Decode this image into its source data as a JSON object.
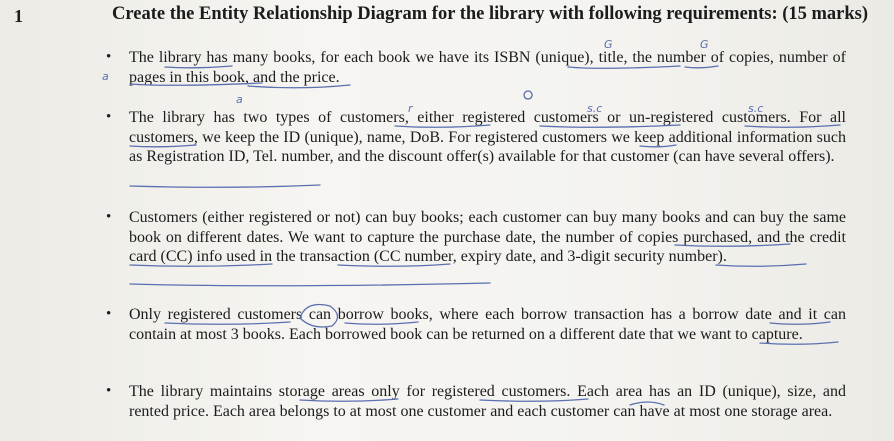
{
  "question": {
    "number": "1",
    "title": "Create the Entity Relationship Diagram for the library with following requirements: (15 marks)"
  },
  "bullets": [
    {
      "text": "The library has many books, for each book we have its ISBN (unique), title, the number of copies, number of pages in this book, and the price."
    },
    {
      "text": "The library has two types of customers, either registered customers or un-registered customers. For all customers, we keep the ID (unique), name, DoB. For registered customers we keep additional information such as Registration ID, Tel. number, and the discount offer(s) available for that customer (can have several offers)."
    },
    {
      "text": "Customers (either registered or not) can buy books; each customer can buy many books and can buy the same book on different dates. We want to capture the purchase date, the number of copies purchased, and the credit card (CC) info used in the transaction (CC number, expiry date, and 3-digit security number)."
    },
    {
      "text": "Only registered customers can borrow books, where each borrow transaction has a borrow date and it can contain at most 3 books. Each borrowed book can be returned on a different date that we want to capture."
    },
    {
      "text": "The library maintains storage areas only for registered customers. Each area has an ID (unique), size, and rented price. Each area belongs to at most one customer and each customer can have at most one storage area."
    }
  ],
  "handwriting": {
    "mark_a1": "a",
    "mark_a2": "a",
    "mark_a3": "a",
    "mark_r": "r",
    "mark_sc1": "s.c",
    "mark_sc2": "s.c",
    "mark_g1": "G",
    "mark_g2": "G"
  },
  "ink_color": "#5a6fb0"
}
